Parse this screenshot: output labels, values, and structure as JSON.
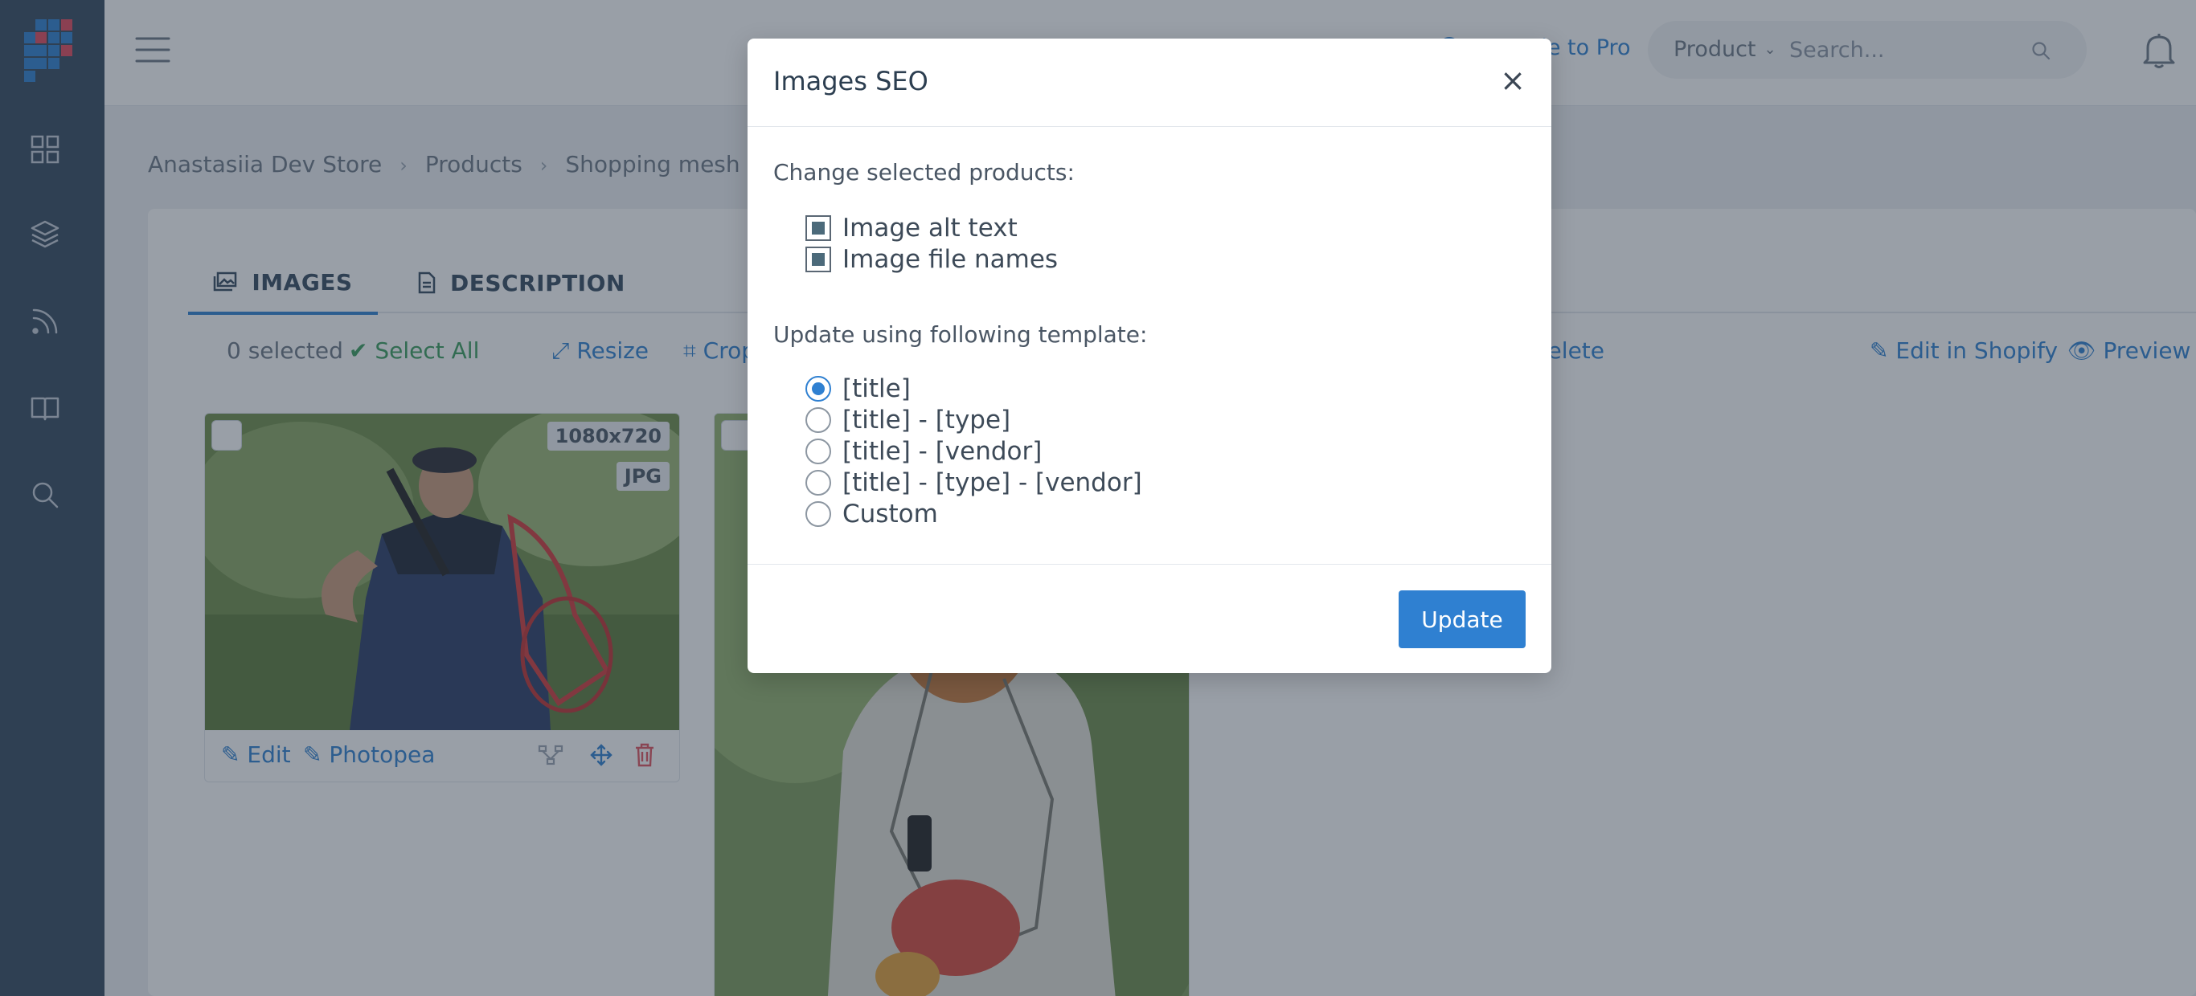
{
  "topbar": {
    "upgrade_label": "Upgrade to Pro",
    "search_type": "Product",
    "search_placeholder": "Search..."
  },
  "breadcrumb": {
    "items": [
      "Anastasiia Dev Store",
      "Products",
      "Shopping mesh bag"
    ]
  },
  "tabs": [
    {
      "label": "IMAGES",
      "active": true
    },
    {
      "label": "DESCRIPTION",
      "active": false
    }
  ],
  "toolbar": {
    "selected": "0 selected",
    "select_all": "Select All",
    "resize": "Resize",
    "crop": "Crop",
    "delete": "Delete",
    "edit_in_shopify": "Edit in Shopify",
    "preview": "Preview"
  },
  "images": [
    {
      "dimensions": "1080x720",
      "format": "JPG",
      "edit": "Edit",
      "photopea": "Photopea"
    }
  ],
  "modal": {
    "title": "Images SEO",
    "close": "×",
    "change_label": "Change selected products:",
    "checkboxes": [
      {
        "label": "Image alt text",
        "checked": true
      },
      {
        "label": "Image file names",
        "checked": true
      }
    ],
    "template_label": "Update using following template:",
    "templates": [
      {
        "label": "[title]",
        "selected": true
      },
      {
        "label": "[title] - [type]",
        "selected": false
      },
      {
        "label": "[title] - [vendor]",
        "selected": false
      },
      {
        "label": "[title] - [type] - [vendor]",
        "selected": false
      },
      {
        "label": "Custom",
        "selected": false
      }
    ],
    "update_button": "Update"
  },
  "colors": {
    "sidebar": "#34495e",
    "accent": "#2f80d1",
    "success": "#3a9d5d",
    "overlay": "rgba(42,54,72,0.48)"
  }
}
